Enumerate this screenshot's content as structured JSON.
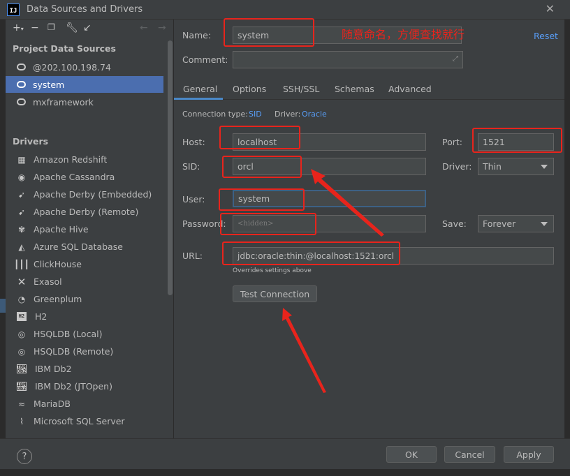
{
  "window": {
    "title": "Data Sources and Drivers",
    "app_icon_text": "IJ"
  },
  "sidebar": {
    "section_data_sources": "Project Data Sources",
    "data_sources": [
      {
        "label": "@202.100.198.74"
      },
      {
        "label": "system"
      },
      {
        "label": "mxframework"
      }
    ],
    "section_drivers": "Drivers",
    "drivers": [
      {
        "label": "Amazon Redshift",
        "icon": "redshift-icon"
      },
      {
        "label": "Apache Cassandra",
        "icon": "cassandra-icon"
      },
      {
        "label": "Apache Derby (Embedded)",
        "icon": "derby-icon"
      },
      {
        "label": "Apache Derby (Remote)",
        "icon": "derby-icon"
      },
      {
        "label": "Apache Hive",
        "icon": "hive-icon"
      },
      {
        "label": "Azure SQL Database",
        "icon": "azure-icon"
      },
      {
        "label": "ClickHouse",
        "icon": "clickhouse-icon"
      },
      {
        "label": "Exasol",
        "icon": "exasol-icon"
      },
      {
        "label": "Greenplum",
        "icon": "greenplum-icon"
      },
      {
        "label": "H2",
        "icon": "h2-icon"
      },
      {
        "label": "HSQLDB (Local)",
        "icon": "hsqldb-icon"
      },
      {
        "label": "HSQLDB (Remote)",
        "icon": "hsqldb-icon"
      },
      {
        "label": "IBM Db2",
        "icon": "ibm-db2-icon"
      },
      {
        "label": "IBM Db2 (JTOpen)",
        "icon": "ibm-db2-icon"
      },
      {
        "label": "MariaDB",
        "icon": "mariadb-icon"
      },
      {
        "label": "Microsoft SQL Server",
        "icon": "mssql-icon"
      }
    ]
  },
  "form": {
    "name_label": "Name:",
    "name_value": "system",
    "reset_label": "Reset",
    "comment_label": "Comment:",
    "comment_value": "",
    "tabs": [
      "General",
      "Options",
      "SSH/SSL",
      "Schemas",
      "Advanced"
    ],
    "connection_type_label": "Connection type:",
    "connection_type_value": "SID",
    "driver_info_label": "Driver:",
    "driver_info_value": "Oracle",
    "host_label": "Host:",
    "host_value": "localhost",
    "port_label": "Port:",
    "port_value": "1521",
    "sid_label": "SID:",
    "sid_value": "orcl",
    "driver_label": "Driver:",
    "driver_value": "Thin",
    "user_label": "User:",
    "user_value": "system",
    "password_label": "Password:",
    "password_value": "<hidden>",
    "save_label": "Save:",
    "save_value": "Forever",
    "url_label": "URL:",
    "url_value": "jdbc:oracle:thin:@localhost:1521:orcl",
    "url_hint": "Overrides settings above",
    "test_connection_label": "Test Connection"
  },
  "footer": {
    "help": "?",
    "ok": "OK",
    "cancel": "Cancel",
    "apply": "Apply"
  },
  "annotation": {
    "text": "随意命名，方便查找就行",
    "color": "#e8241c"
  },
  "colors": {
    "accent": "#4b6eaf",
    "link": "#589df6",
    "annotation": "#e8241c"
  }
}
